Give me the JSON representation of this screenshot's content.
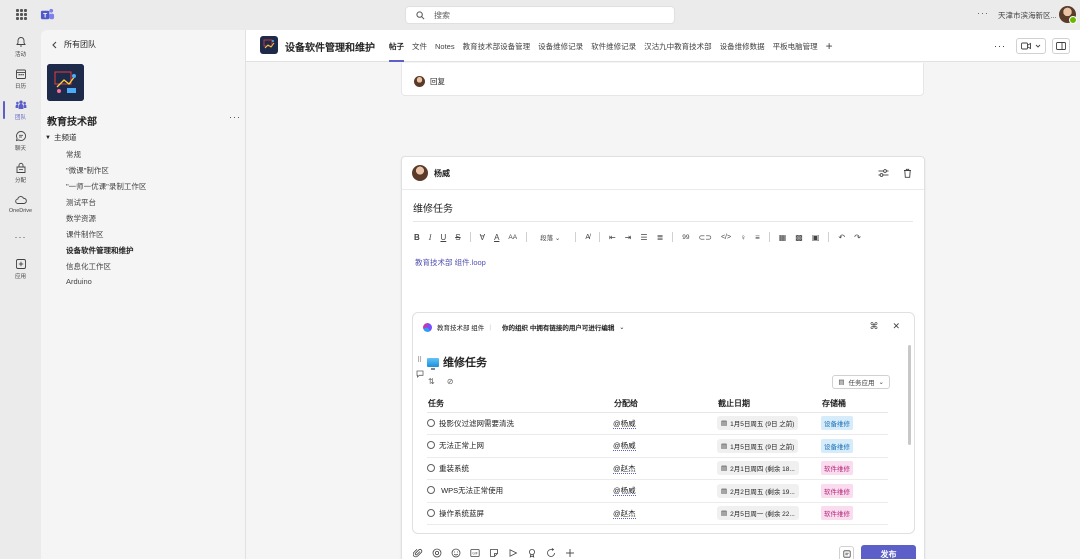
{
  "topbar": {
    "search_placeholder": "搜索",
    "more": "···",
    "org_name": "天津市滨海新区..."
  },
  "rail": [
    {
      "label": "活动",
      "icon": "bell-icon"
    },
    {
      "label": "日历",
      "icon": "calendar-icon"
    },
    {
      "label": "团队",
      "icon": "teams-icon"
    },
    {
      "label": "聊天",
      "icon": "chat-icon"
    },
    {
      "label": "分配",
      "icon": "assignment-icon"
    },
    {
      "label": "OneDrive",
      "icon": "cloud-icon"
    },
    {
      "label": "···",
      "icon": "more-icon"
    },
    {
      "label": "应用",
      "icon": "apps-icon"
    }
  ],
  "team_panel": {
    "back_label": "所有团队",
    "team_name": "教育技术部",
    "more": "···",
    "section": "主频道",
    "channels": [
      "常规",
      "\"微课\"制作区",
      "\"一师一优课\"录制工作区",
      "测试平台",
      "数学资源",
      "课件制作区",
      "设备软件管理和维护",
      "信息化工作区",
      "Arduino"
    ]
  },
  "channel": {
    "title": "设备软件管理和维护",
    "tabs": [
      "帖子",
      "文件",
      "Notes",
      "教育技术部设备管理",
      "设备维修记录",
      "软件维修记录",
      "汉沽九中教育技术部",
      "设备维修数据",
      "平板电脑管理"
    ],
    "active_tab": "帖子",
    "more": "···"
  },
  "reply": {
    "label": "回复"
  },
  "compose": {
    "author": "杨威",
    "subject": "维修任务",
    "format_bar": {
      "bold": "B",
      "italic": "I",
      "underline": "U",
      "strike": "S",
      "font_size": "AA",
      "style": "段落",
      "quote": "99"
    },
    "loop_link": "教育技术部 组件.loop",
    "post_label": "发布"
  },
  "loop": {
    "workspace": "教育技术部 组件",
    "sharing": "你的组织 中拥有链接的用户可进行编辑",
    "title": "维修任务",
    "task_app_label": "任务应用",
    "columns": [
      "任务",
      "分配给",
      "截止日期",
      "存储桶"
    ],
    "rows": [
      {
        "task": "投影仪过滤网需要清洗",
        "assignee": "@杨威",
        "due": "1月5日周五 (9日 之前)",
        "bucket": "设备维修"
      },
      {
        "task": "无法正常上网",
        "assignee": "@杨威",
        "due": "1月5日周五 (9日 之前)",
        "bucket": "设备维修"
      },
      {
        "task": "重装系统",
        "assignee": "@赵杰",
        "due": "2月1日周四 (剩余 18...",
        "bucket": "软件维修"
      },
      {
        "task": " WPS无法正常使用",
        "assignee": "@杨威",
        "due": "2月2日周五 (剩余 19...",
        "bucket": "软件维修"
      },
      {
        "task": "操作系统蓝屏",
        "assignee": "@赵杰",
        "due": "2月5日周一 (剩余 22...",
        "bucket": "软件维修"
      }
    ]
  },
  "colors": {
    "accent": "#5b5fc7",
    "bucket_device_bg": "#d6ecfa",
    "bucket_device_fg": "#1a6fb5",
    "bucket_software_bg": "#fadcef",
    "bucket_software_fg": "#b4267a"
  }
}
